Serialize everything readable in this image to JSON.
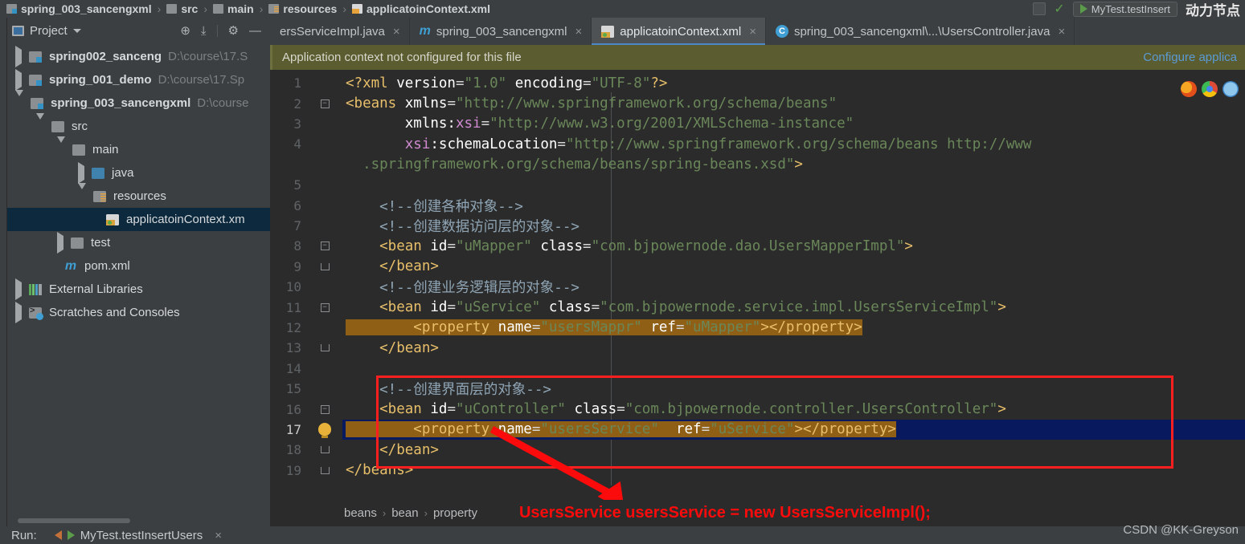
{
  "topbar": {
    "breadcrumbs": [
      {
        "label": "spring_003_sancengxml",
        "icon": "module-icon",
        "bold": true
      },
      {
        "label": "src",
        "icon": "folder-icon",
        "bold": true
      },
      {
        "label": "main",
        "icon": "folder-icon",
        "bold": true
      },
      {
        "label": "resources",
        "icon": "resources-folder-icon",
        "bold": true
      },
      {
        "label": "applicatoinContext.xml",
        "icon": "xml-file-icon",
        "bold": true
      }
    ],
    "separator": "›",
    "run_config": "MyTest.testInsert",
    "cjk_overlay": "动力节点"
  },
  "project_panel": {
    "title": "Project",
    "tools": [
      {
        "name": "locate-icon",
        "glyph": "⊕"
      },
      {
        "name": "collapse-all-icon",
        "glyph": "⤓"
      },
      {
        "name": "settings-gear-icon",
        "glyph": "⚙"
      },
      {
        "name": "hide-panel-icon",
        "glyph": "—"
      }
    ],
    "tree": [
      {
        "indent": 0,
        "toggle": "collapsed",
        "icon": "module-icon",
        "label": "spring002_sanceng",
        "path": "D:\\course\\17.S",
        "bold": true,
        "selected": false
      },
      {
        "indent": 0,
        "toggle": "collapsed",
        "icon": "module-icon",
        "label": "spring_001_demo",
        "path": "D:\\course\\17.Sp",
        "bold": true,
        "selected": false
      },
      {
        "indent": 0,
        "toggle": "expanded",
        "icon": "module-icon",
        "label": "spring_003_sancengxml",
        "path": "D:\\course",
        "bold": true,
        "selected": false
      },
      {
        "indent": 1,
        "toggle": "expanded",
        "icon": "folder-icon",
        "label": "src",
        "path": "",
        "bold": false,
        "selected": false
      },
      {
        "indent": 2,
        "toggle": "expanded",
        "icon": "folder-icon",
        "label": "main",
        "path": "",
        "bold": false,
        "selected": false
      },
      {
        "indent": 3,
        "toggle": "collapsed",
        "icon": "java-source-folder-icon",
        "label": "java",
        "path": "",
        "bold": false,
        "selected": false
      },
      {
        "indent": 3,
        "toggle": "expanded",
        "icon": "resources-folder-icon",
        "label": "resources",
        "path": "",
        "bold": false,
        "selected": false
      },
      {
        "indent": 4,
        "toggle": "none",
        "icon": "xml-file-icon",
        "label": "applicatoinContext.xm",
        "path": "",
        "bold": false,
        "selected": true
      },
      {
        "indent": 2,
        "toggle": "collapsed",
        "icon": "folder-icon",
        "label": "test",
        "path": "",
        "bold": false,
        "selected": false
      },
      {
        "indent": 2,
        "toggle": "none",
        "icon": "maven-icon",
        "label": "pom.xml",
        "path": "",
        "bold": false,
        "selected": false
      },
      {
        "indent": 0,
        "toggle": "collapsed",
        "icon": "libraries-icon",
        "label": "External Libraries",
        "path": "",
        "bold": false,
        "selected": false
      },
      {
        "indent": 0,
        "toggle": "collapsed",
        "icon": "scratches-icon",
        "label": "Scratches and Consoles",
        "path": "",
        "bold": false,
        "selected": false
      }
    ]
  },
  "editor": {
    "tabs": [
      {
        "label": "ersServiceImpl.java",
        "icon": "java-class-icon",
        "active": false,
        "closable": true
      },
      {
        "label": "spring_003_sancengxml",
        "icon": "maven-icon",
        "active": false,
        "closable": true
      },
      {
        "label": "applicatoinContext.xml",
        "icon": "xml-file-icon",
        "active": true,
        "closable": true
      },
      {
        "label": "spring_003_sancengxml\\...\\UsersController.java",
        "icon": "java-class-icon",
        "active": false,
        "closable": true
      }
    ],
    "close_glyph": "×",
    "notification": {
      "message": "Application context not configured for this file",
      "action": "Configure applica"
    },
    "browser_icons": [
      "firefox-icon",
      "chrome-icon",
      "safari-icon"
    ],
    "lines": [
      {
        "num": "1",
        "marker": "none",
        "highlight": "none",
        "tokens": [
          {
            "t": "<?xml ",
            "c": "k-tag"
          },
          {
            "t": "version",
            "c": "k-attr"
          },
          {
            "t": "=",
            "c": "k-plain"
          },
          {
            "t": "\"1.0\"",
            "c": "k-val"
          },
          {
            "t": " ",
            "c": "k-plain"
          },
          {
            "t": "encoding",
            "c": "k-attr"
          },
          {
            "t": "=",
            "c": "k-plain"
          },
          {
            "t": "\"UTF-8\"",
            "c": "k-val"
          },
          {
            "t": "?>",
            "c": "k-tag"
          }
        ]
      },
      {
        "num": "2",
        "marker": "fold-open",
        "highlight": "none",
        "tokens": [
          {
            "t": "<beans ",
            "c": "k-tag"
          },
          {
            "t": "xmlns",
            "c": "k-attr"
          },
          {
            "t": "=",
            "c": "k-plain"
          },
          {
            "t": "\"http://www.springframework.org/schema/beans\"",
            "c": "k-val"
          }
        ]
      },
      {
        "num": "3",
        "marker": "none",
        "highlight": "none",
        "tokens": [
          {
            "t": "       xmlns:",
            "c": "k-attr"
          },
          {
            "t": "xsi",
            "c": "k-ns"
          },
          {
            "t": "=",
            "c": "k-plain"
          },
          {
            "t": "\"http://www.w3.org/2001/XMLSchema-instance\"",
            "c": "k-val"
          }
        ]
      },
      {
        "num": "4",
        "marker": "none",
        "highlight": "none",
        "tokens": [
          {
            "t": "       ",
            "c": "k-plain"
          },
          {
            "t": "xsi",
            "c": "k-ns"
          },
          {
            "t": ":schemaLocation",
            "c": "k-attr"
          },
          {
            "t": "=",
            "c": "k-plain"
          },
          {
            "t": "\"http://www.springframework.org/schema/beans http://www",
            "c": "k-val"
          }
        ]
      },
      {
        "num": "",
        "marker": "none",
        "highlight": "none",
        "tokens": [
          {
            "t": "  .springframework.org/schema/beans/spring-beans.xsd\"",
            "c": "k-val"
          },
          {
            "t": ">",
            "c": "k-tag"
          }
        ]
      },
      {
        "num": "5",
        "marker": "none",
        "highlight": "none",
        "tokens": []
      },
      {
        "num": "6",
        "marker": "none",
        "highlight": "none",
        "tokens": [
          {
            "t": "    <!--创建各种对象-->",
            "c": "k-cmt"
          }
        ]
      },
      {
        "num": "7",
        "marker": "none",
        "highlight": "none",
        "tokens": [
          {
            "t": "    <!--创建数据访问层的对象-->",
            "c": "k-cmt"
          }
        ]
      },
      {
        "num": "8",
        "marker": "fold-open",
        "highlight": "none",
        "tokens": [
          {
            "t": "    <bean ",
            "c": "k-tag"
          },
          {
            "t": "id",
            "c": "k-attr"
          },
          {
            "t": "=",
            "c": "k-plain"
          },
          {
            "t": "\"uMapper\"",
            "c": "k-val"
          },
          {
            "t": " ",
            "c": "k-plain"
          },
          {
            "t": "class",
            "c": "k-attr"
          },
          {
            "t": "=",
            "c": "k-plain"
          },
          {
            "t": "\"com.bjpowernode.dao.UsersMapperImpl\"",
            "c": "k-val"
          },
          {
            "t": ">",
            "c": "k-tag"
          }
        ]
      },
      {
        "num": "9",
        "marker": "fold-close",
        "highlight": "none",
        "tokens": [
          {
            "t": "    </bean>",
            "c": "k-tag"
          }
        ]
      },
      {
        "num": "10",
        "marker": "none",
        "highlight": "none",
        "tokens": [
          {
            "t": "    <!--创建业务逻辑层的对象-->",
            "c": "k-cmt"
          }
        ]
      },
      {
        "num": "11",
        "marker": "fold-open",
        "highlight": "none",
        "tokens": [
          {
            "t": "    <bean ",
            "c": "k-tag"
          },
          {
            "t": "id",
            "c": "k-attr"
          },
          {
            "t": "=",
            "c": "k-plain"
          },
          {
            "t": "\"uService\"",
            "c": "k-val"
          },
          {
            "t": " ",
            "c": "k-plain"
          },
          {
            "t": "class",
            "c": "k-attr"
          },
          {
            "t": "=",
            "c": "k-plain"
          },
          {
            "t": "\"com.bjpowernode.service.impl.UsersServiceImpl\"",
            "c": "k-val"
          },
          {
            "t": ">",
            "c": "k-tag"
          }
        ]
      },
      {
        "num": "12",
        "marker": "none",
        "highlight": "orange",
        "tokens": [
          {
            "t": "        <property ",
            "c": "k-tag"
          },
          {
            "t": "name",
            "c": "k-attr"
          },
          {
            "t": "=",
            "c": "k-plain"
          },
          {
            "t": "\"usersMappr\"",
            "c": "k-val"
          },
          {
            "t": " ",
            "c": "k-plain"
          },
          {
            "t": "ref",
            "c": "k-attr"
          },
          {
            "t": "=",
            "c": "k-plain"
          },
          {
            "t": "\"uMapper\"",
            "c": "k-val"
          },
          {
            "t": "></property>",
            "c": "k-tag"
          }
        ]
      },
      {
        "num": "13",
        "marker": "fold-close",
        "highlight": "none",
        "tokens": [
          {
            "t": "    </bean>",
            "c": "k-tag"
          }
        ]
      },
      {
        "num": "14",
        "marker": "none",
        "highlight": "none",
        "tokens": []
      },
      {
        "num": "15",
        "marker": "none",
        "highlight": "none",
        "tokens": [
          {
            "t": "    <!--创建界面层的对象-->",
            "c": "k-cmt"
          }
        ]
      },
      {
        "num": "16",
        "marker": "fold-open",
        "highlight": "none",
        "tokens": [
          {
            "t": "    <bean ",
            "c": "k-tag"
          },
          {
            "t": "id",
            "c": "k-attr"
          },
          {
            "t": "=",
            "c": "k-plain"
          },
          {
            "t": "\"uController\"",
            "c": "k-val"
          },
          {
            "t": " ",
            "c": "k-plain"
          },
          {
            "t": "class",
            "c": "k-attr"
          },
          {
            "t": "=",
            "c": "k-plain"
          },
          {
            "t": "\"com.bjpowernode.controller.UsersController\"",
            "c": "k-val"
          },
          {
            "t": ">",
            "c": "k-tag"
          }
        ]
      },
      {
        "num": "17",
        "marker": "bulb",
        "highlight": "current-orange",
        "tokens": [
          {
            "t": "        <property ",
            "c": "k-tag"
          },
          {
            "t": "name",
            "c": "k-attr"
          },
          {
            "t": "=",
            "c": "k-plain"
          },
          {
            "t": "\"usersService\"",
            "c": "k-val"
          },
          {
            "t": "  ",
            "c": "k-plain"
          },
          {
            "t": "ref",
            "c": "k-attr"
          },
          {
            "t": "=",
            "c": "k-plain"
          },
          {
            "t": "\"uService\"",
            "c": "k-val"
          },
          {
            "t": "></property>",
            "c": "k-tag"
          }
        ]
      },
      {
        "num": "18",
        "marker": "fold-close",
        "highlight": "none",
        "tokens": [
          {
            "t": "    </bean>",
            "c": "k-tag"
          }
        ]
      },
      {
        "num": "19",
        "marker": "fold-close",
        "highlight": "none",
        "tokens": [
          {
            "t": "</beans>",
            "c": "k-tag"
          }
        ]
      }
    ]
  },
  "status": {
    "breadcrumbs": [
      "beans",
      "bean",
      "property"
    ],
    "separator": "›",
    "annotation": "UsersService usersService = new UsersServiceImpl();",
    "annotation_color": "#fb0b0b"
  },
  "runbar": {
    "label": "Run:",
    "tab": "MyTest.testInsertUsers",
    "close_glyph": "×"
  },
  "watermark": "CSDN @KK-Greyson"
}
